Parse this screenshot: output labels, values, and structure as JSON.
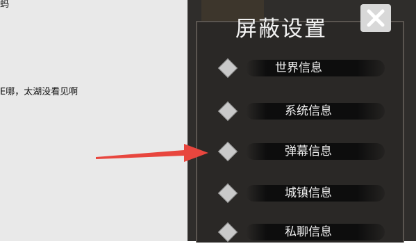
{
  "chat": {
    "line1": "蚂",
    "line2": "E哪，太湖没看见啊"
  },
  "panel": {
    "title": "屏蔽设置",
    "close_icon": "close-icon",
    "items": [
      {
        "label": "世界信息"
      },
      {
        "label": "系统信息"
      },
      {
        "label": "弹幕信息"
      },
      {
        "label": "城镇信息"
      },
      {
        "label": "私聊信息"
      }
    ]
  },
  "annotation": {
    "arrow_color": "#e8463e",
    "points_to": "弹幕信息"
  }
}
